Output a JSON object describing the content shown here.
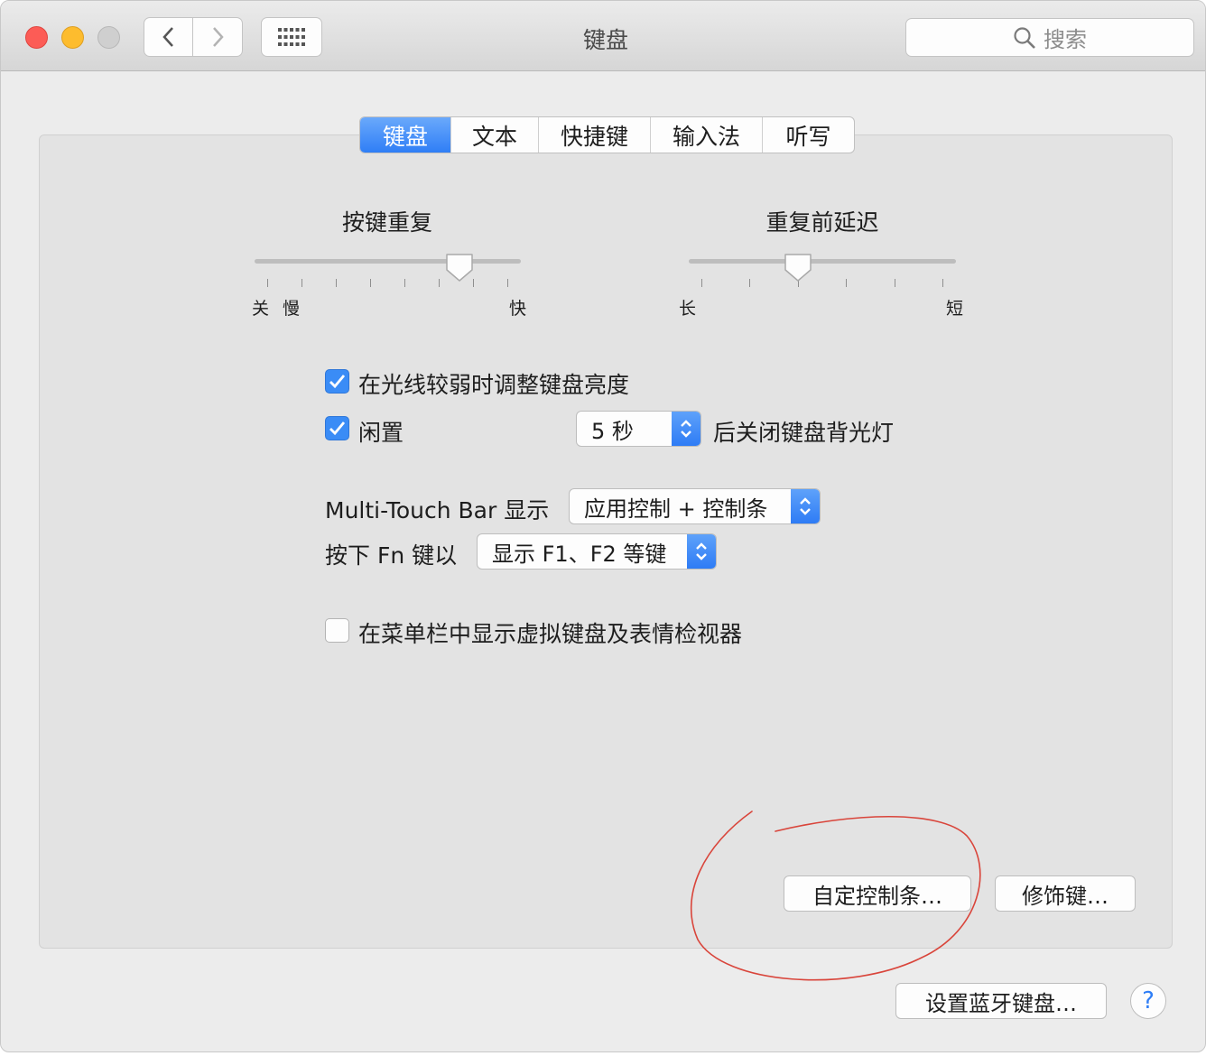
{
  "window": {
    "title": "键盘"
  },
  "toolbar": {
    "search_placeholder": "搜索"
  },
  "tabs": [
    {
      "label": "键盘",
      "active": true
    },
    {
      "label": "文本",
      "active": false
    },
    {
      "label": "快捷键",
      "active": false
    },
    {
      "label": "输入法",
      "active": false
    },
    {
      "label": "听写",
      "active": false
    }
  ],
  "key_repeat": {
    "title": "按键重复",
    "labels": {
      "off": "关",
      "slow": "慢",
      "fast": "快"
    },
    "level": 0.8
  },
  "delay_until_repeat": {
    "title": "重复前延迟",
    "labels": {
      "long": "长",
      "short": "短"
    },
    "level": 0.4
  },
  "adjust_brightness": {
    "label": "在光线较弱时调整键盘亮度",
    "checked": true
  },
  "backlight_idle": {
    "label": "闲置",
    "checked": true,
    "value": "5 秒",
    "suffix": "后关闭键盘背光灯"
  },
  "touch_bar": {
    "label": "Multi-Touch Bar 显示",
    "value": "应用控制 + 控制条"
  },
  "fn_key": {
    "label": "按下 Fn 键以",
    "value": "显示 F1、F2 等键"
  },
  "show_viewer": {
    "label": "在菜单栏中显示虚拟键盘及表情检视器",
    "checked": false
  },
  "buttons": {
    "customize_control_strip": "自定控制条…",
    "modifier_keys": "修饰键…",
    "bluetooth_keyboard": "设置蓝牙键盘…",
    "help": "?"
  },
  "colors": {
    "accent": "#2f7ef6",
    "annotation": "#d9453b",
    "close": "#fc5c56",
    "minimize": "#fdbc2e"
  }
}
